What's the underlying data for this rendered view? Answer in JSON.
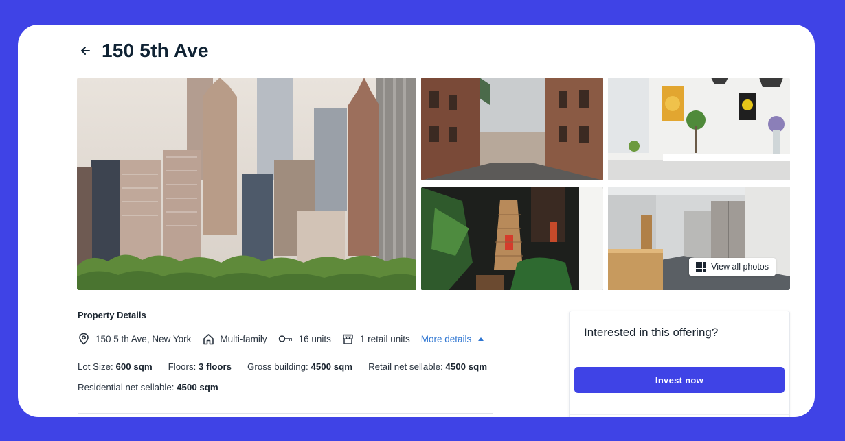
{
  "page": {
    "title": "150 5th Ave",
    "back_icon": "arrow-left-icon"
  },
  "gallery": {
    "view_all_label": "View all photos",
    "view_all_icon": "grid-icon"
  },
  "details": {
    "section_title": "Property Details",
    "address": "150 5 th Ave, New York",
    "type": "Multi-family",
    "units": "16 units",
    "retail_units": "1 retail units",
    "more_label": "More details",
    "metrics": [
      {
        "label": "Lot Size: ",
        "value": "600 sqm"
      },
      {
        "label": "Floors: ",
        "value": "3 floors"
      },
      {
        "label": "Gross building: ",
        "value": "4500 sqm"
      },
      {
        "label": "Retail net sellable: ",
        "value": "4500 sqm"
      },
      {
        "label": "Residential net sellable: ",
        "value": "4500 sqm"
      }
    ]
  },
  "offer": {
    "title": "Interested in this offering?",
    "button_label": "Invest now"
  },
  "colors": {
    "brand": "#3f43e6",
    "link": "#2f76d2",
    "heading": "#0f2233"
  }
}
